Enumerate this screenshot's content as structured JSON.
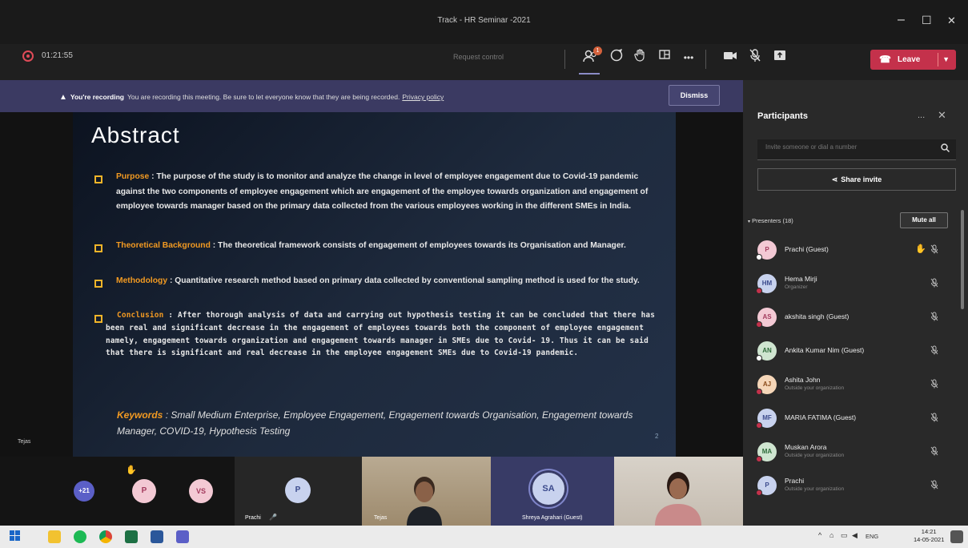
{
  "window": {
    "title": "Track - HR Seminar -2021",
    "minimize": "–",
    "maximize": "☐",
    "close": "✕"
  },
  "toolbar": {
    "timer": "01:21:55",
    "request_control": "Request control",
    "participants_badge": "1",
    "leave_label": "Leave"
  },
  "recording_banner": {
    "title": "You're recording",
    "message": "You are recording this meeting. Be sure to let everyone know that they are being recorded.",
    "link": "Privacy policy",
    "dismiss": "Dismiss"
  },
  "slide": {
    "title": "Abstract",
    "purpose_label": "Purpose",
    "purpose_text": ": The purpose of the study is to monitor and analyze the change in level of employee engagement due to Covid-19 pandemic against the two components of employee engagement which are engagement of the employee towards organization and engagement of employee towards manager based on the primary data collected from the various employees working in the different SMEs in India.",
    "background_label": "Theoretical Background",
    "background_text": ": The theoretical framework consists of engagement of employees towards its Organisation and Manager.",
    "methodology_label": "Methodology",
    "methodology_text": ": Quantitative research method based on primary data collected by conventional sampling method is used for the study.",
    "conclusion_label": "Conclusion",
    "conclusion_text": ": After thorough analysis of data and carrying out hypothesis testing it can be concluded that there has been real and significant decrease in the engagement of employees towards both the component of employee engagement namely, engagement towards organization and engagement towards manager in SMEs due to Covid- 19. Thus it can be said that there is significant and real decrease in the employee engagement SMEs due to Covid-19 pandemic.",
    "keywords_label": "Keywords",
    "keywords_text": ": Small Medium Enterprise, Employee Engagement, Engagement towards Organisation, Engagement towards Manager, COVID-19, Hypothesis Testing",
    "page_number": "2",
    "presenter_label": "Tejas"
  },
  "gallery": {
    "overflow_count": "+21",
    "tiles": [
      {
        "initials": "P",
        "color": "#f3c9d4"
      },
      {
        "initials": "VS",
        "color": "#f3c9d4"
      },
      {
        "initials": "P",
        "name": "Prachi",
        "color": "#c8d2ee"
      },
      {
        "name": "Tejas"
      },
      {
        "initials": "SA",
        "name": "Shreya Agrahari (Guest)",
        "color": "#c8d2ee"
      },
      {
        "name": ""
      }
    ]
  },
  "participants": {
    "title": "Participants",
    "more": "...",
    "invite_placeholder": "Invite someone or dial a number",
    "share_invite": "Share invite",
    "presenters_header": "Presenters (18)",
    "mute_all": "Mute all",
    "list": [
      {
        "initials": "P",
        "name": "Prachi (Guest)",
        "sub": "",
        "avatar_color": "#f3c9d4",
        "text_color": "#a33b5e",
        "hand": true
      },
      {
        "initials": "HM",
        "name": "Hema Mirji",
        "sub": "Organizer",
        "avatar_color": "#c8d2ee",
        "text_color": "#3b4a8c",
        "hand": false
      },
      {
        "initials": "AS",
        "name": "akshita singh (Guest)",
        "sub": "",
        "avatar_color": "#f3c9d4",
        "text_color": "#a33b5e",
        "hand": false
      },
      {
        "initials": "AN",
        "name": "Ankita Kumar Nim (Guest)",
        "sub": "",
        "avatar_color": "#cfe5d0",
        "text_color": "#2f6b3a",
        "hand": false
      },
      {
        "initials": "AJ",
        "name": "Ashita John",
        "sub": "Outside your organization",
        "avatar_color": "#f5d6b8",
        "text_color": "#8a4b1a",
        "hand": false
      },
      {
        "initials": "MF",
        "name": "MARIA FATIMA (Guest)",
        "sub": "",
        "avatar_color": "#c8d2ee",
        "text_color": "#3b4a8c",
        "hand": false
      },
      {
        "initials": "MA",
        "name": "Muskan Arora",
        "sub": "Outside your organization",
        "avatar_color": "#cfe5d0",
        "text_color": "#2f6b3a",
        "hand": false
      },
      {
        "initials": "P",
        "name": "Prachi",
        "sub": "Outside your organization",
        "avatar_color": "#c8d2ee",
        "text_color": "#3b4a8c",
        "hand": false
      }
    ]
  },
  "taskbar": {
    "lang": "ENG",
    "time": "14:21",
    "date": "14-05-2021"
  }
}
